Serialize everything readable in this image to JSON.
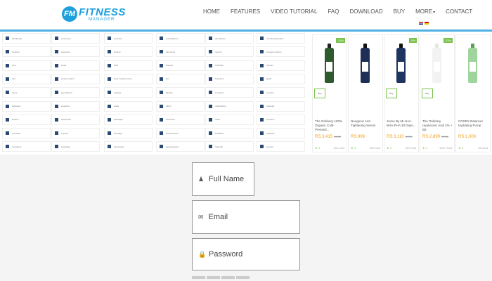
{
  "header": {
    "logo_badge": "FM",
    "logo_title": "FITNESS",
    "logo_subtitle": "MANAGER",
    "nav": [
      "HOME",
      "FEATURES",
      "VIDEO TUTORIAL",
      "FAQ",
      "DOWNLOAD",
      "BUY",
      "MORE",
      "CONTACT"
    ],
    "accent_color": "#1ea0dc"
  },
  "feature_grid": {
    "icon_color": "#2b4a73",
    "rows": [
      [
        "dashboard",
        "customers",
        "products",
        "subscriptions",
        "attendance",
        "membership plans"
      ],
      [
        "invoices",
        "expenses",
        "income",
        "payments",
        "reports",
        "progress photos"
      ],
      [
        "sms",
        "email",
        "staff",
        "classes",
        "schedule",
        "trainers"
      ],
      [
        "diet",
        "workout plans",
        "body measurement",
        "bmi",
        "branches",
        "goals"
      ],
      [
        "users",
        "permissions",
        "settings",
        "backup",
        "inventory",
        "vendors"
      ],
      [
        "followups",
        "enquiries",
        "leads",
        "offers",
        "notifications",
        "calendar"
      ],
      [
        "lockers",
        "equipment",
        "packages",
        "discounts",
        "taxes",
        "coupons"
      ],
      [
        "renewals",
        "expiries",
        "birthdays",
        "anniversaries",
        "feedback",
        "analytics"
      ],
      [
        "reminders",
        "templates",
        "documents",
        "appointments",
        "referrals",
        "support"
      ]
    ]
  },
  "products": [
    {
      "badge": "-11%",
      "name": "The Ordinary 100% Organic Cold-Pressed...",
      "price": "RS.3,415",
      "old_price": "3,842",
      "rating": "4",
      "sold": "168 Sold",
      "tag": "Buy",
      "bottle": "#2f5a2d",
      "cap": "#222"
    },
    {
      "badge": "",
      "name": "Neogenic Anti Tightening Serum",
      "price": "RS.999",
      "old_price": "",
      "rating": "4",
      "sold": "138 Sold",
      "tag": "",
      "bottle": "#1e2e55",
      "cap": "#111"
    },
    {
      "badge": "-5%",
      "name": "Some By Mi AHA-BHA-PHA 30 Days...",
      "price": "RS.3,110",
      "old_price": "3,299",
      "rating": "4",
      "sold": "349 Sold",
      "tag": "Buy",
      "bottle": "#1d3560",
      "cap": "#111"
    },
    {
      "badge": "-23%",
      "name": "The Ordinary Hyaluronic Acid 2% + B5",
      "price": "RS.2,899",
      "old_price": "3,760",
      "rating": "4",
      "sold": "1547 Sold",
      "tag": "Buy",
      "bottle": "#f2f2f2",
      "cap": "#e5e5e5"
    },
    {
      "badge": "",
      "name": "COSRX Balancer Hydrating Pump",
      "price": "RS.1,000",
      "old_price": "",
      "rating": "4",
      "sold": "88 Sold",
      "tag": "",
      "bottle": "#9fd49c",
      "cap": "#5aa24f"
    }
  ],
  "login_form": {
    "full_name_placeholder": "Full Name",
    "email_placeholder": "Email",
    "password_placeholder": "Password"
  }
}
